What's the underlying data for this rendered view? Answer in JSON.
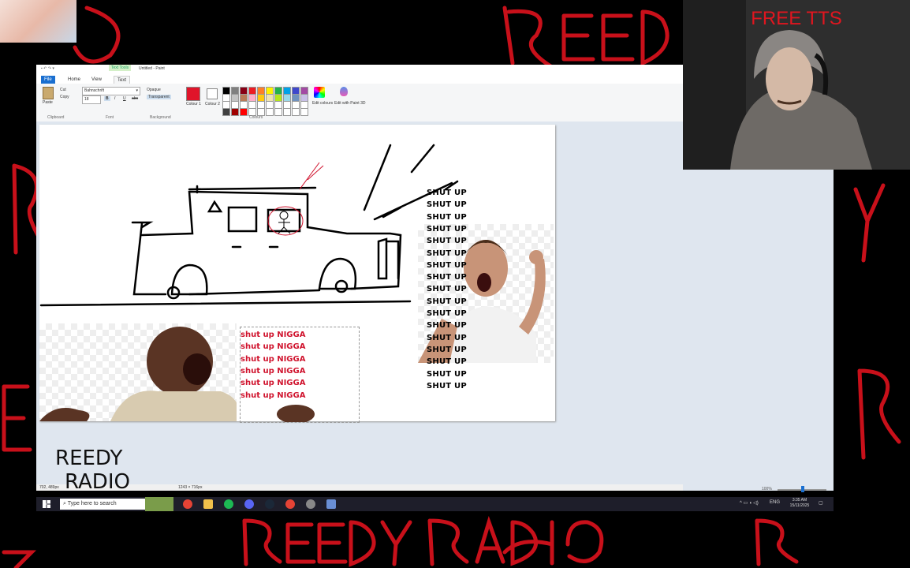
{
  "overlay": {
    "brand_text": "REEDY RADIO",
    "brand_color": "#c8101a",
    "logo_line1": "REEDY",
    "logo_line2": "RADIO"
  },
  "webcam": {
    "label": "FREE TTS"
  },
  "paint": {
    "context_tab": "Text Tools",
    "window_title": "Untitled - Paint",
    "tabs": [
      "File",
      "Home",
      "View",
      "Text"
    ],
    "clipboard": {
      "paste": "Paste",
      "cut": "Cut",
      "copy": "Copy",
      "label": "Clipboard"
    },
    "font": {
      "family": "Bahnschrift",
      "size": "18",
      "label": "Font"
    },
    "background": {
      "opaque": "Opaque",
      "transparent": "Transparent",
      "label": "Background"
    },
    "colours": {
      "colour1": "Colour 1",
      "colour2": "Colour 2",
      "edit": "Edit colours",
      "paint3d": "Edit with Paint 3D",
      "label": "Colours",
      "active": "#e0142a",
      "palette": [
        "#000000",
        "#7f7f7f",
        "#880015",
        "#ed1c24",
        "#ff7f27",
        "#fff200",
        "#22b14c",
        "#00a2e8",
        "#3f48cc",
        "#a349a4",
        "#ffffff",
        "#c3c3c3",
        "#b97a57",
        "#ffaec9",
        "#ffc90e",
        "#efe4b0",
        "#b5e61d",
        "#99d9ea",
        "#7092be",
        "#c8bfe7",
        "#ffffff",
        "#ffffff",
        "#ffffff",
        "#ffffff",
        "#ffffff",
        "#ffffff",
        "#ffffff",
        "#ffffff",
        "#ffffff",
        "#ffffff",
        "#404040",
        "#a00000",
        "#ff0000",
        "#ffffff",
        "#ffffff",
        "#ffffff",
        "#ffffff",
        "#ffffff",
        "#ffffff",
        "#ffffff"
      ]
    },
    "canvas_text": {
      "shut_up_lines": [
        "SHUT UP",
        "SHUT UP",
        "SHUT UP",
        "SHUT UP",
        "SHUT UP",
        "SHUT UP",
        "SHUT UP",
        "SHUT UP",
        "SHUT UP",
        "SHUT UP",
        "SHUT UP",
        "SHUT UP",
        "SHUT UP",
        "SHUT UP",
        "SHUT UP",
        "SHUT UP",
        "SHUT UP"
      ],
      "red_lines": [
        "shut up NIGGA",
        "shut up NIGGA",
        "shut up NIGGA",
        "shut up NIGGA",
        "shut up NIGGA",
        "shut up NIGGA"
      ]
    },
    "status": {
      "position": "702, 489px",
      "dimensions": "1243 × 716px",
      "zoom": "100%"
    }
  },
  "taskbar": {
    "search_placeholder": "Type here to search",
    "lang": "ENG",
    "time": "3:35 AM",
    "date": "15/11/2025"
  }
}
